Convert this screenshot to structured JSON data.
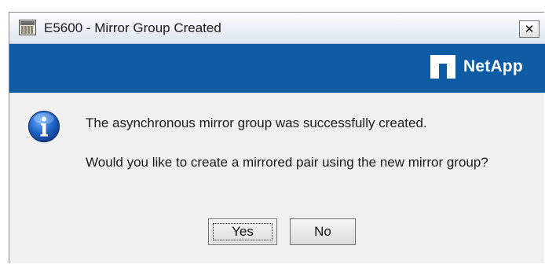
{
  "window": {
    "title": "E5600 - Mirror Group Created",
    "close_label": "✕"
  },
  "banner": {
    "brand": "NetApp",
    "color": "#0f5ba4"
  },
  "dialog": {
    "icon": "info-icon",
    "message_primary": "The asynchronous mirror group was successfully created.",
    "message_secondary": "Would you like to create a mirrored pair using the new mirror group?"
  },
  "buttons": {
    "yes_label": "Yes",
    "no_label": "No"
  }
}
